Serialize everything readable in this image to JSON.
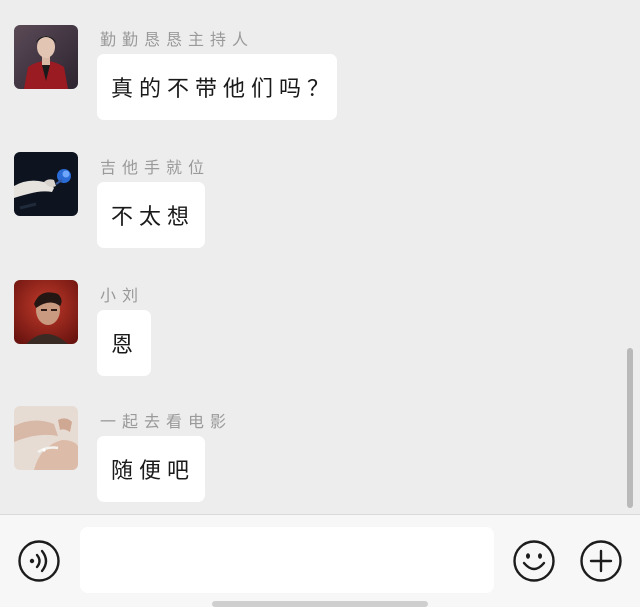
{
  "messages": [
    {
      "sender": "勤勤恳恳主持人",
      "text": "真的不带他们吗？",
      "avatar_icon": "man-in-red-suit-avatar"
    },
    {
      "sender": "吉他手就位",
      "text": "不太想",
      "avatar_icon": "hand-holding-blue-rose-avatar"
    },
    {
      "sender": "小刘",
      "text": "恩",
      "avatar_icon": "man-portrait-red-background-avatar"
    },
    {
      "sender": "一起去看电影",
      "text": "随便吧",
      "avatar_icon": "hands-with-bracelet-avatar"
    }
  ],
  "input_bar": {
    "voice_icon": "voice-icon",
    "message_value": "",
    "emoji_icon": "emoji-icon",
    "more_icon": "plus-icon"
  },
  "colors": {
    "chat_background": "#ededed",
    "bubble": "#ffffff",
    "sender_text": "#9a9a9a",
    "message_text": "#1a1a1a",
    "input_bar_background": "#f7f7f7"
  }
}
